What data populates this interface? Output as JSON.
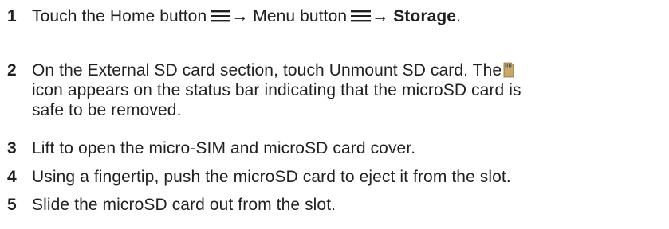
{
  "steps": [
    {
      "number": "1",
      "parts": {
        "a": "Touch the Home button",
        "arrow1": "→ Menu button",
        "arrow2": "→ ",
        "bold": "Storage",
        "end": "."
      },
      "icons": [
        "menu-icon",
        "menu-icon"
      ]
    },
    {
      "number": "2",
      "lines": [
        "On the External SD card section, touch Unmount SD card. The",
        "icon appears on the status bar indicating that the microSD card is",
        "safe to be removed."
      ],
      "icons": [
        "sd-card-icon"
      ]
    },
    {
      "number": "3",
      "text": "Lift to open the micro-SIM and microSD card cover."
    },
    {
      "number": "4",
      "text": "Using a fingertip, push the microSD card to eject it from the slot."
    },
    {
      "number": "5",
      "text": "Slide the microSD card out from the slot."
    }
  ],
  "colors": {
    "text": "#231f20",
    "sd_icon_body": "#c8a96a",
    "sd_icon_contacts": "#5a5a5a"
  }
}
